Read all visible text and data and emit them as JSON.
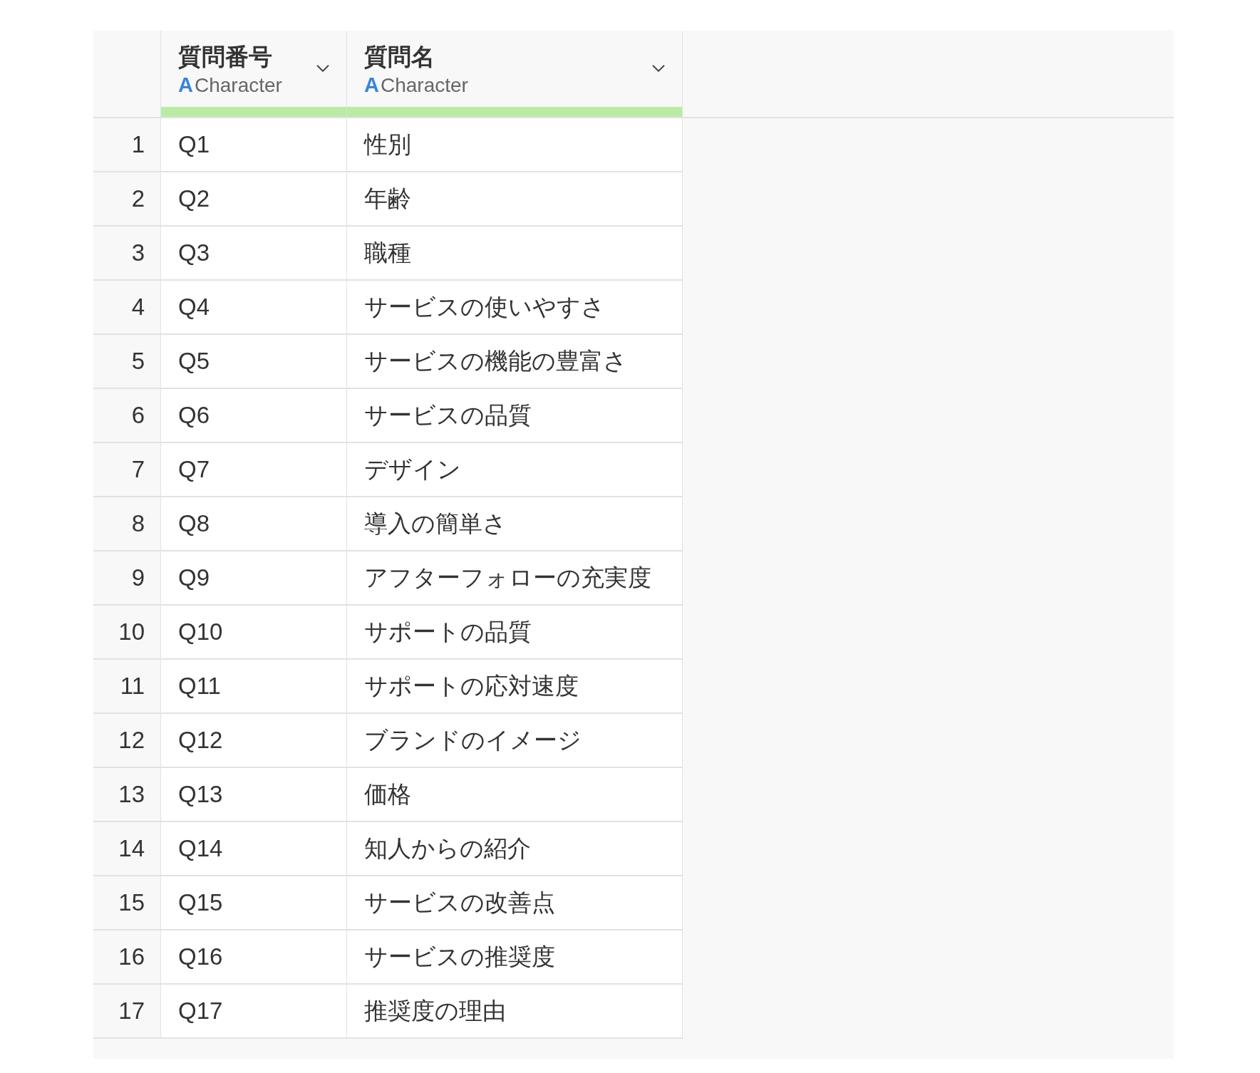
{
  "columns": [
    {
      "name": "質問番号",
      "type_glyph": "A",
      "type_label": "Character"
    },
    {
      "name": "質問名",
      "type_glyph": "A",
      "type_label": "Character"
    }
  ],
  "rows": [
    {
      "index": "1",
      "cells": [
        "Q1",
        "性別"
      ]
    },
    {
      "index": "2",
      "cells": [
        "Q2",
        "年齢"
      ]
    },
    {
      "index": "3",
      "cells": [
        "Q3",
        "職種"
      ]
    },
    {
      "index": "4",
      "cells": [
        "Q4",
        "サービスの使いやすさ"
      ]
    },
    {
      "index": "5",
      "cells": [
        "Q5",
        "サービスの機能の豊富さ"
      ]
    },
    {
      "index": "6",
      "cells": [
        "Q6",
        "サービスの品質"
      ]
    },
    {
      "index": "7",
      "cells": [
        "Q7",
        "デザイン"
      ]
    },
    {
      "index": "8",
      "cells": [
        "Q8",
        "導入の簡単さ"
      ]
    },
    {
      "index": "9",
      "cells": [
        "Q9",
        "アフターフォローの充実度"
      ]
    },
    {
      "index": "10",
      "cells": [
        "Q10",
        "サポートの品質"
      ]
    },
    {
      "index": "11",
      "cells": [
        "Q11",
        "サポートの応対速度"
      ]
    },
    {
      "index": "12",
      "cells": [
        "Q12",
        "ブランドのイメージ"
      ]
    },
    {
      "index": "13",
      "cells": [
        "Q13",
        "価格"
      ]
    },
    {
      "index": "14",
      "cells": [
        "Q14",
        "知人からの紹介"
      ]
    },
    {
      "index": "15",
      "cells": [
        "Q15",
        "サービスの改善点"
      ]
    },
    {
      "index": "16",
      "cells": [
        "Q16",
        "サービスの推奨度"
      ]
    },
    {
      "index": "17",
      "cells": [
        "Q17",
        "推奨度の理由"
      ]
    }
  ]
}
